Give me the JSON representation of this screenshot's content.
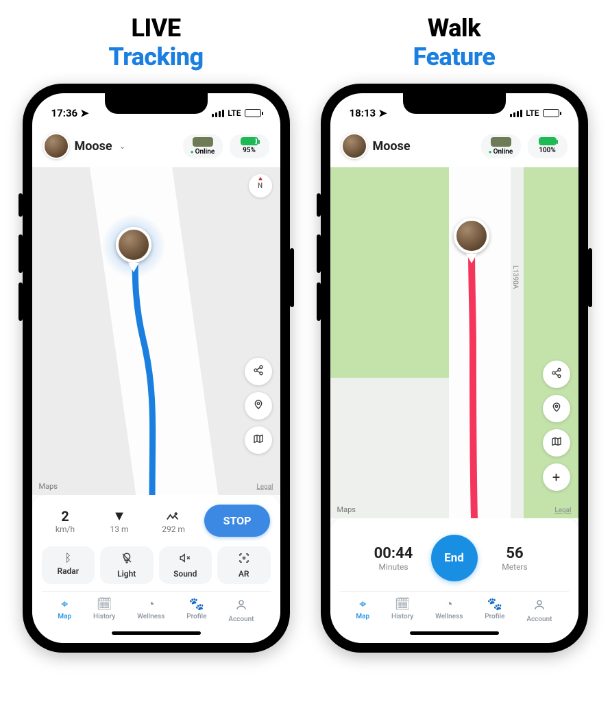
{
  "titles": {
    "left_top": "LIVE",
    "left_bottom": "Tracking",
    "right_top": "Walk",
    "right_bottom": "Feature"
  },
  "left": {
    "status": {
      "time": "17:36",
      "network": "LTE"
    },
    "pet": {
      "name": "Moose",
      "online_label": "Online",
      "battery_label": "95%"
    },
    "map": {
      "compass": "N",
      "attribution": "Maps",
      "legal": "Legal"
    },
    "metrics": {
      "speed_value": "2",
      "speed_unit": "km/h",
      "direction_value": "13 m",
      "elevation_value": "292 m"
    },
    "stop_button": "STOP",
    "actions": {
      "radar": "Radar",
      "light": "Light",
      "sound": "Sound",
      "ar": "AR"
    }
  },
  "right": {
    "status": {
      "time": "18:13",
      "network": "LTE"
    },
    "pet": {
      "name": "Moose",
      "online_label": "Online",
      "battery_label": "100%"
    },
    "map": {
      "attribution": "Maps",
      "legal": "Legal",
      "road_label": "L1390A"
    },
    "walk": {
      "minutes_value": "00:44",
      "minutes_label": "Minutes",
      "end_button": "End",
      "meters_value": "56",
      "meters_label": "Meters"
    }
  },
  "tabs": {
    "map": "Map",
    "history": "History",
    "wellness": "Wellness",
    "profile": "Profile",
    "account": "Account"
  }
}
